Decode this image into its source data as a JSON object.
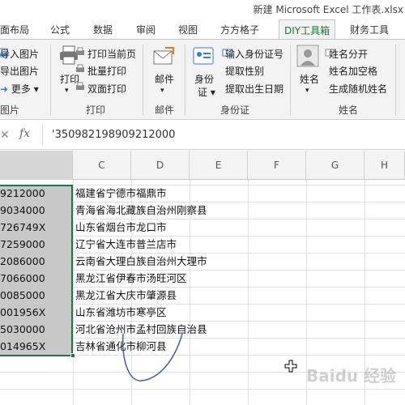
{
  "window": {
    "title": "新建 Microsoft Excel 工作表.xlsx"
  },
  "tabs": [
    {
      "label": "面布局"
    },
    {
      "label": "公式"
    },
    {
      "label": "数据"
    },
    {
      "label": "审阅"
    },
    {
      "label": "视图"
    },
    {
      "label": "方方格子"
    },
    {
      "label": "DIY工具箱"
    },
    {
      "label": "财务工具"
    }
  ],
  "ribbon": {
    "group_image": {
      "items": [
        "导入图片",
        "导出图片",
        "更多 ▾"
      ],
      "label": "图片"
    },
    "group_print": {
      "big_button": "打印",
      "items": [
        "打印当前页",
        "批量打印",
        "双面打印"
      ],
      "label": "打印"
    },
    "group_mail": {
      "big_button": "邮件",
      "label": "邮件"
    },
    "group_idcard": {
      "big_button_line1": "身份",
      "big_button_line2": "证 ▾",
      "items": [
        "输入身份证号",
        "提取性别",
        "提取出生日期"
      ],
      "label": "身份证"
    },
    "group_name": {
      "big_button": "姓名",
      "items": [
        "姓名分开",
        "姓名加空格",
        "生成随机姓名"
      ],
      "label": "姓名"
    }
  },
  "formula_bar": {
    "cancel_glyph": "✕",
    "fx": "fx",
    "value": "'350982198909212000"
  },
  "columns": [
    "C",
    "D",
    "E",
    "F",
    "G",
    "H"
  ],
  "rows": [
    {
      "a": "9212000",
      "c": "福建省宁德市福鼎市"
    },
    {
      "a": "9034000",
      "c": "青海省海北藏族自治州刚察县"
    },
    {
      "a": "726749X",
      "c": "山东省烟台市龙口市"
    },
    {
      "a": "7259000",
      "c": "辽宁省大连市普兰店市"
    },
    {
      "a": "2086000",
      "c": "云南省大理白族自治州大理市"
    },
    {
      "a": "7066000",
      "c": "黑龙江省伊春市汤旺河区"
    },
    {
      "a": "0085000",
      "c": "黑龙江省大庆市肇源县"
    },
    {
      "a": "001956X",
      "c": "山东省潍坊市寒亭区"
    },
    {
      "a": "5030000",
      "c": "河北省沧州市孟村回族自治县"
    },
    {
      "a": "014965X",
      "c": "吉林省通化市柳河县"
    }
  ],
  "watermark": "Baidu 经验",
  "colors": {
    "accent": "#217346",
    "selection": "#c8c8c8"
  }
}
